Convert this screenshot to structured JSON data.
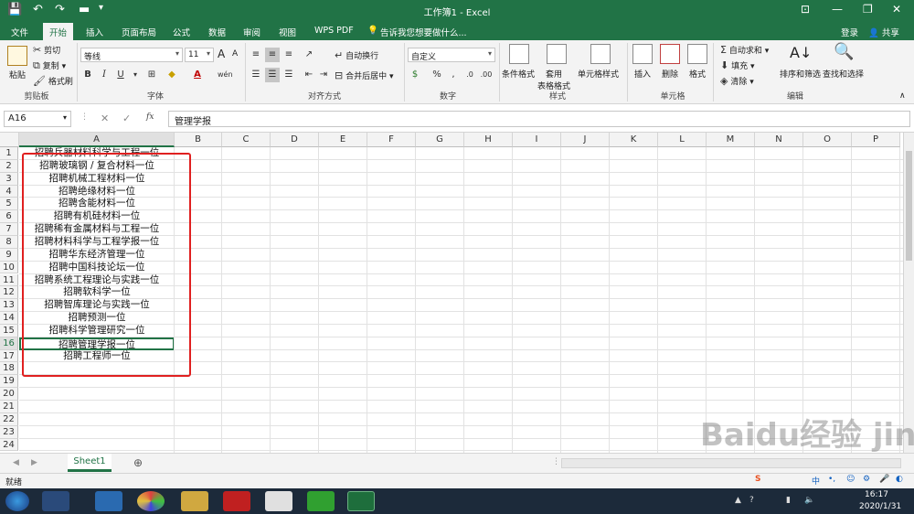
{
  "window": {
    "title": "工作簿1 - Excel",
    "user_login": "登录",
    "share": "共享"
  },
  "tabs": [
    "文件",
    "开始",
    "插入",
    "页面布局",
    "公式",
    "数据",
    "审阅",
    "视图",
    "WPS PDF"
  ],
  "active_tab": "开始",
  "tellme": "告诉我您想要做什么...",
  "ribbon": {
    "clipboard": {
      "paste": "粘贴",
      "cut": "剪切",
      "copy": "复制",
      "format_painter": "格式刷",
      "label": "剪贴板"
    },
    "font": {
      "name": "等线",
      "size": "11",
      "bold": "B",
      "italic": "I",
      "underline": "U",
      "label": "字体"
    },
    "alignment": {
      "wrap": "自动换行",
      "merge": "合并后居中",
      "label": "对齐方式"
    },
    "number": {
      "format": "自定义",
      "percent": "%",
      "comma": ",",
      "label": "数字"
    },
    "styles": {
      "conditional": "条件格式",
      "table": "套用\n表格格式",
      "cell_styles": "单元格样式",
      "label": "样式"
    },
    "cells": {
      "insert": "插入",
      "delete": "删除",
      "format": "格式",
      "label": "单元格"
    },
    "editing": {
      "autosum": "自动求和",
      "fill": "填充",
      "clear": "清除",
      "sort": "排序和筛选",
      "find": "查找和选择",
      "label": "编辑"
    }
  },
  "formula_bar": {
    "name_box": "A16",
    "content": "管理学报"
  },
  "columns": [
    "A",
    "B",
    "C",
    "D",
    "E",
    "F",
    "G",
    "H",
    "I",
    "J",
    "K",
    "L",
    "M",
    "N",
    "O",
    "P"
  ],
  "rows": [
    "招聘兵器材料科学与工程一位",
    "招聘玻璃钢 / 复合材料一位",
    "招聘机械工程材料一位",
    "招聘绝缘材料一位",
    "招聘含能材料一位",
    "招聘有机硅材料一位",
    "招聘稀有金属材料与工程一位",
    "招聘材料科学与工程学报一位",
    "招聘华东经济管理一位",
    "招聘中国科技论坛一位",
    "招聘系统工程理论与实践一位",
    "招聘软科学一位",
    "招聘智库理论与实践一位",
    "招聘预测一位",
    "招聘科学管理研究一位",
    "招聘管理学报一位",
    "招聘工程师一位",
    "",
    "",
    "",
    "",
    "",
    "",
    ""
  ],
  "selected_row": 16,
  "sheet_tab": "Sheet1",
  "status": "就绪",
  "clock": {
    "time": "16:17",
    "date": "2020/1/31"
  },
  "taskbar_apps": [
    "start-orb",
    "app-1",
    "sogou",
    "app-3",
    "explorer",
    "youdao",
    "app-6",
    "wechat",
    "excel"
  ],
  "ime": "中",
  "watermark": "Baidu经验 jingyan.baidu.com",
  "colors": {
    "excel_green": "#217346",
    "annotation_red": "#e02020",
    "grid_line": "#d4d4d4"
  }
}
